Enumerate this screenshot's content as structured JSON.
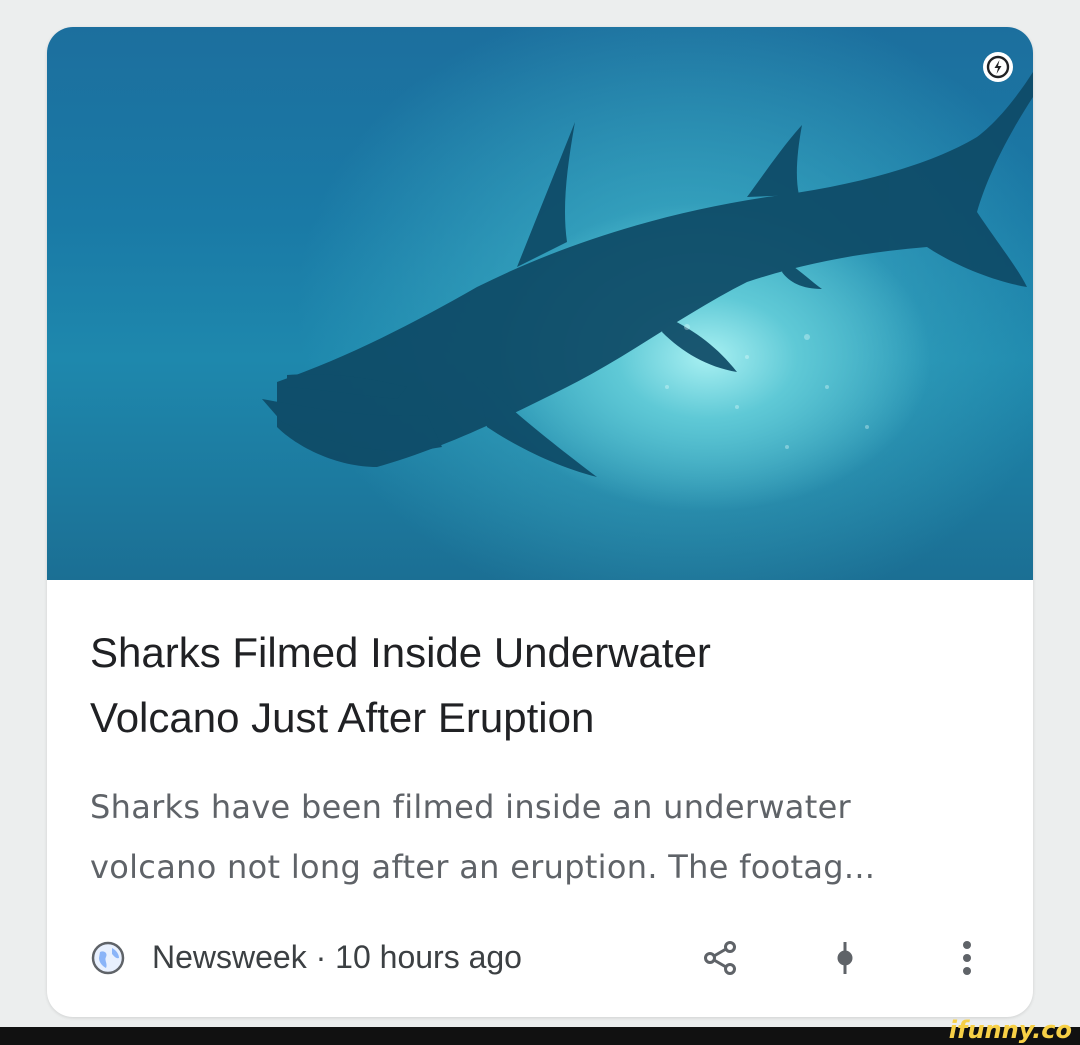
{
  "article": {
    "title_line1": "Sharks Filmed Inside Underwater",
    "title_line2": "Volcano Just After Eruption",
    "snippet_line1": "Sharks have been filmed inside an underwater",
    "snippet_line2": "volcano not long after an eruption. The footag...",
    "source": "Newsweek · 10 hours ago"
  },
  "icons": {
    "amp": "amp-lightning-icon",
    "publisher": "globe-icon",
    "share": "share-icon",
    "save": "bookmark-icon",
    "menu": "more-vert-icon"
  },
  "watermark": "ifunny.co",
  "colors": {
    "background": "#eceeee",
    "card": "#ffffff",
    "title": "#202124",
    "snippet": "#5f6368",
    "icon": "#5f6368",
    "globe": "#8ab4f8"
  }
}
